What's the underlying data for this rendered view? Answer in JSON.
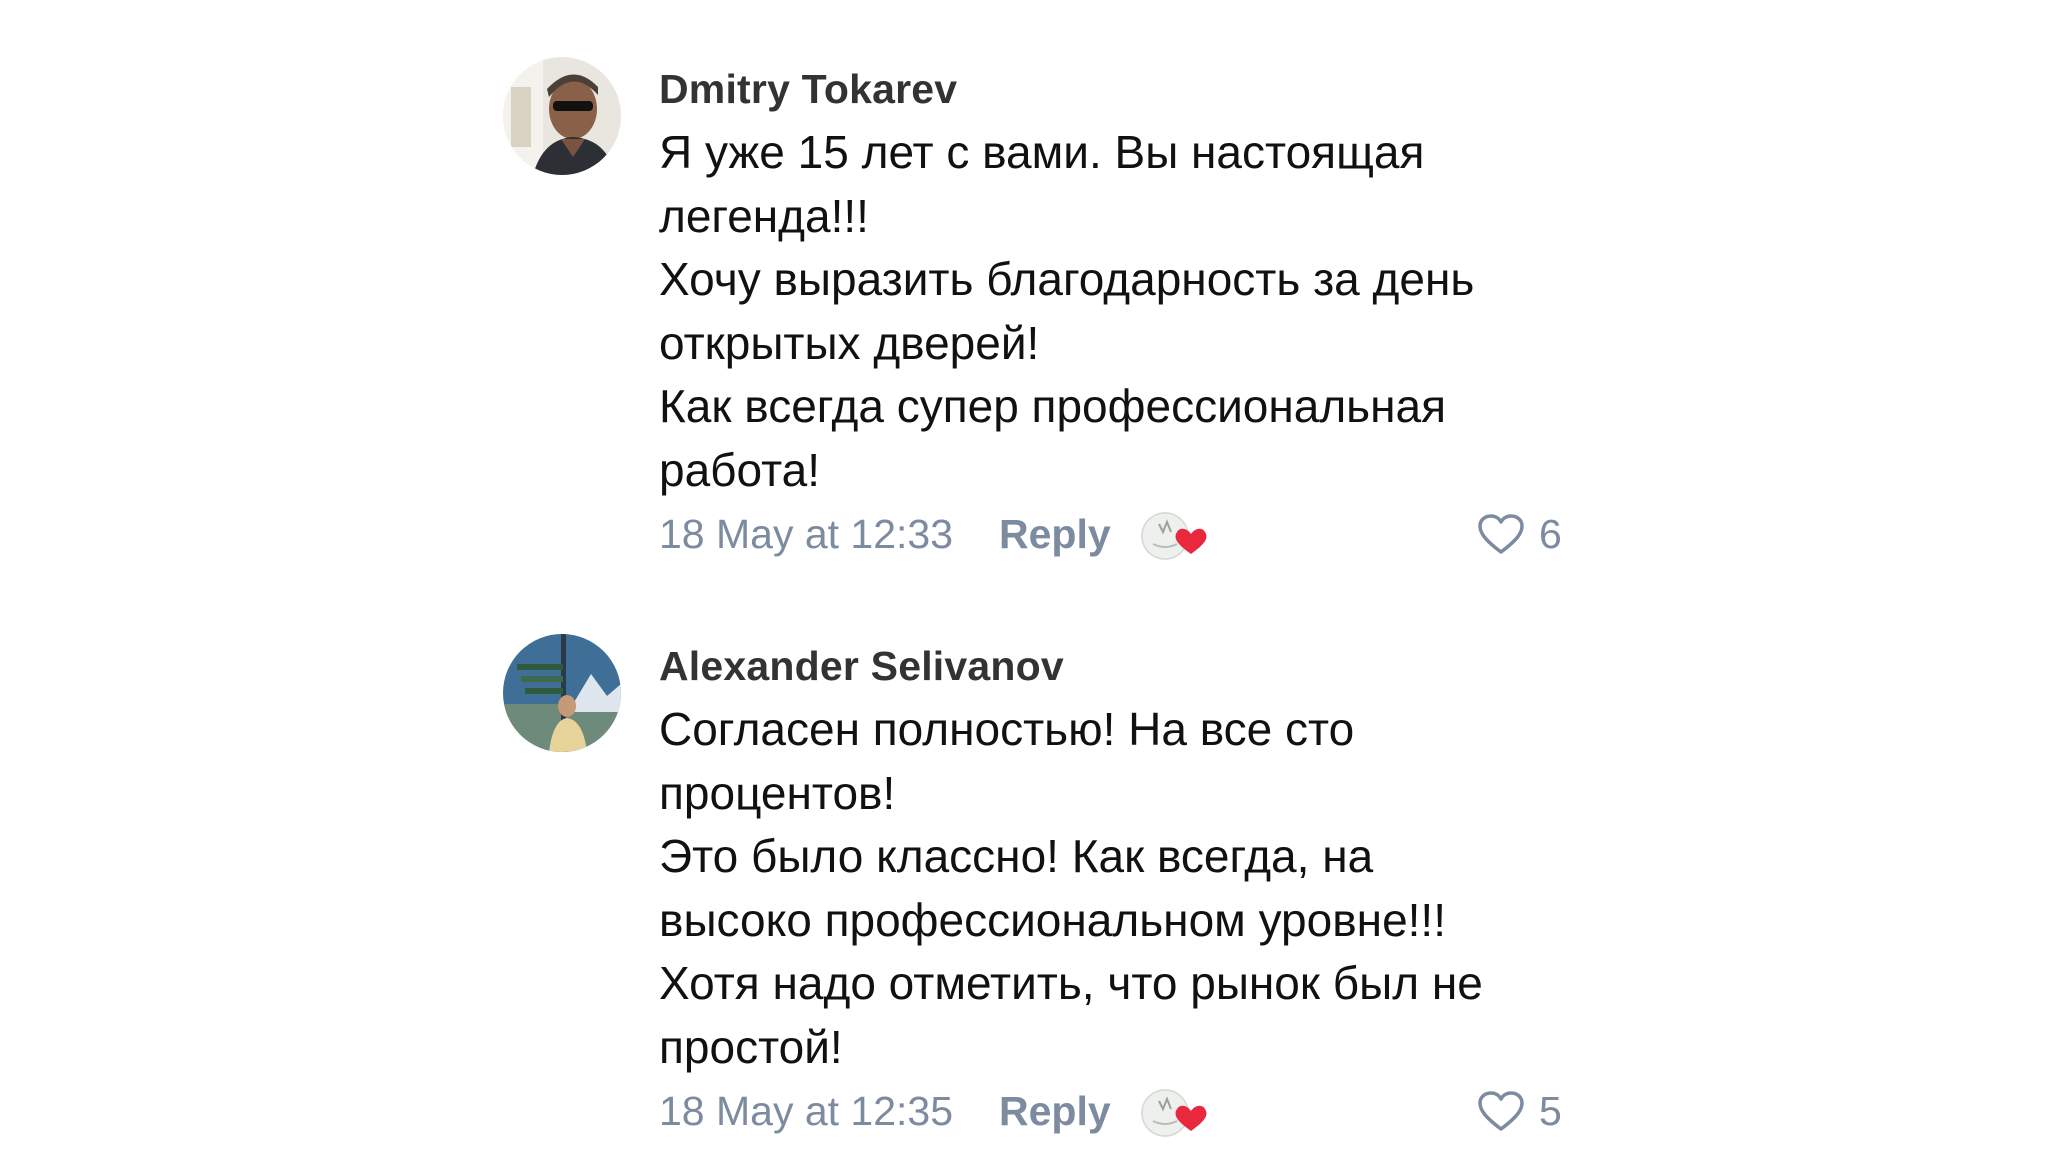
{
  "comments": [
    {
      "author": "Dmitry Tokarev",
      "avatar_icon": "user-photo-avatar",
      "lines": [
        "Я уже 15 лет с вами. Вы настоящая",
        "легенда!!!",
        "Хочу выразить благодарность за день",
        "открытых дверей!",
        "Как всегда супер профессиональная",
        "работа!"
      ],
      "date": "18 May at 12:33",
      "reply_label": "Reply",
      "reaction_icon": "reaction-heart-icon",
      "like_icon": "heart-outline-icon",
      "likes": "6"
    },
    {
      "author": "Alexander Selivanov",
      "avatar_icon": "user-photo-avatar",
      "lines": [
        "Согласен полностью! На все сто",
        "процентов!",
        "Это было классно! Как всегда, на",
        "высоко профессиональном уровне!!!",
        "Хотя надо отметить, что рынок был не",
        "простой!"
      ],
      "date": "18 May at 12:35",
      "reply_label": "Reply",
      "reaction_icon": "reaction-heart-icon",
      "like_icon": "heart-outline-icon",
      "likes": "5"
    }
  ],
  "colors": {
    "author": "#333333",
    "text": "#111111",
    "meta": "#7d8ba1",
    "reaction_heart": "#e8283c",
    "background": "#ffffff"
  }
}
